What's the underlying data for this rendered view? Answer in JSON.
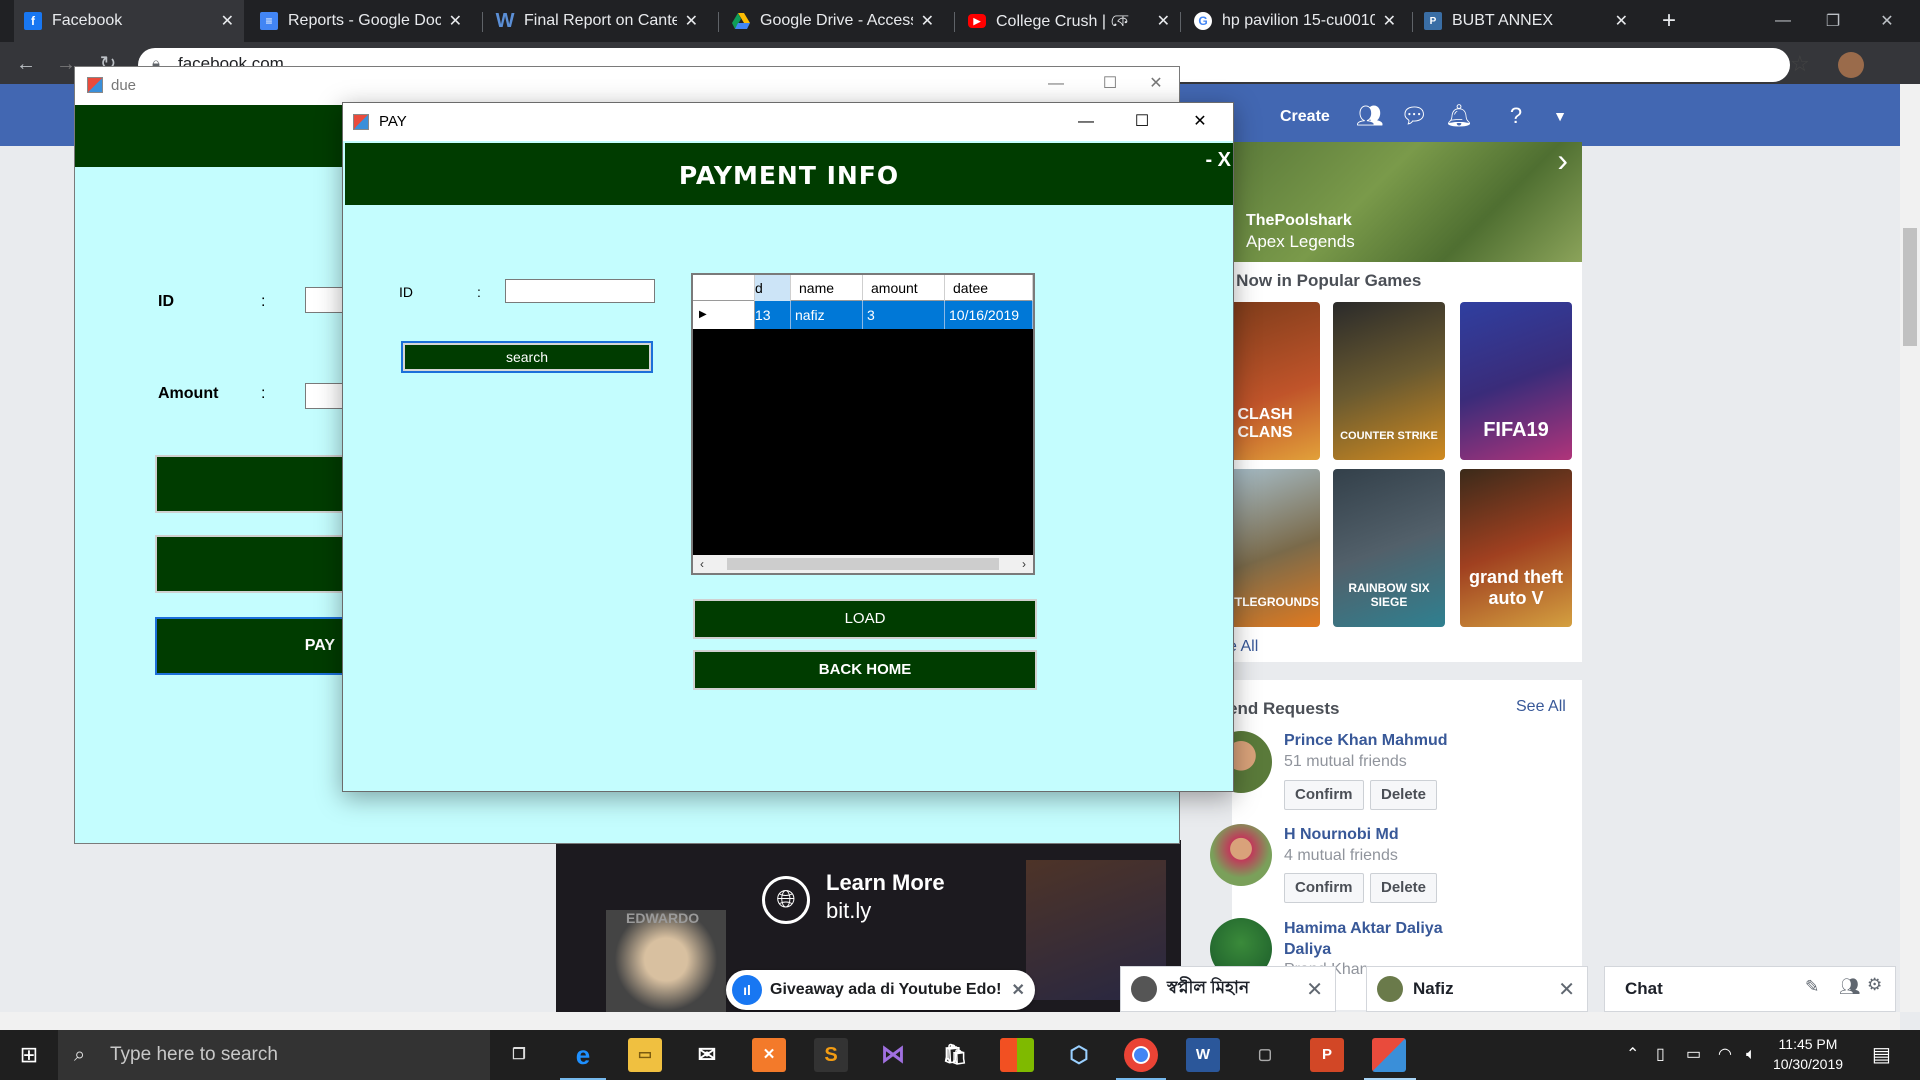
{
  "browser": {
    "tabs": [
      {
        "label": "Facebook",
        "icon": "facebook-icon"
      },
      {
        "label": "Reports - Google Docs",
        "icon": "google-docs-icon"
      },
      {
        "label": "Final Report on Cantee",
        "icon": "word-icon"
      },
      {
        "label": "Google Drive - Access",
        "icon": "google-drive-icon"
      },
      {
        "label": "College Crush | কে",
        "icon": "youtube-icon"
      },
      {
        "label": "hp pavilion 15-cu0010",
        "icon": "google-icon"
      },
      {
        "label": "BUBT ANNEX",
        "icon": "app-icon"
      }
    ],
    "url": "facebook.com"
  },
  "facebook": {
    "nav": {
      "create": "Create"
    },
    "game_hero": {
      "name": "ThePoolshark",
      "game": "Apex Legends"
    },
    "popular_title": "e Now in Popular Games",
    "games": [
      "CLASH CLANS",
      "COUNTER STRIKE",
      "FIFA19",
      "BATTLEGROUNDS",
      "RAINBOW SIX SIEGE",
      "grand theft auto V"
    ],
    "see_all_games": "e All",
    "friend_requests_title": "end Requests",
    "friend_requests_see_all": "See All",
    "friends": [
      {
        "name": "Prince Khan Mahmud",
        "mutual": "51 mutual friends",
        "confirm": "Confirm",
        "delete": "Delete"
      },
      {
        "name": "H Nournobi Md",
        "mutual": "4 mutual friends",
        "confirm": "Confirm",
        "delete": "Delete"
      },
      {
        "name": "Hamima Aktar Daliya",
        "name2": "Daliya",
        "mutual": "Prand Khan"
      }
    ],
    "ad": {
      "learn_more": "Learn More",
      "link": "bit.ly",
      "giveaway": "Giveaway ada di Youtube Edo!"
    },
    "chat_tabs": [
      "স্বপ্নীল মিহান",
      "Nafiz",
      "Chat"
    ]
  },
  "due_window": {
    "title": "due",
    "id_label": "ID",
    "amount_label": "Amount",
    "colon": ":",
    "pay_button_partial": "PAY"
  },
  "pay_window": {
    "title": "PAY",
    "heading": "PAYMENT INFO",
    "close_text": "- X",
    "id_label": "ID",
    "colon": ":",
    "id_value": "",
    "search_label": "search",
    "grid": {
      "columns": [
        "d",
        "name",
        "amount",
        "datee"
      ],
      "rows": [
        {
          "id": "13",
          "name": "nafiz",
          "amount": "3",
          "datee": "10/16/2019"
        }
      ]
    },
    "load_label": "LOAD",
    "back_home_label": "BACK HOME"
  },
  "taskbar": {
    "search_placeholder": "Type here to search",
    "time": "11:45 PM",
    "date": "10/30/2019"
  },
  "colors": {
    "form_background": "#c4fdfe",
    "form_accent": "#003c00",
    "selection": "#0078d7",
    "facebook_blue": "#4267b2"
  }
}
